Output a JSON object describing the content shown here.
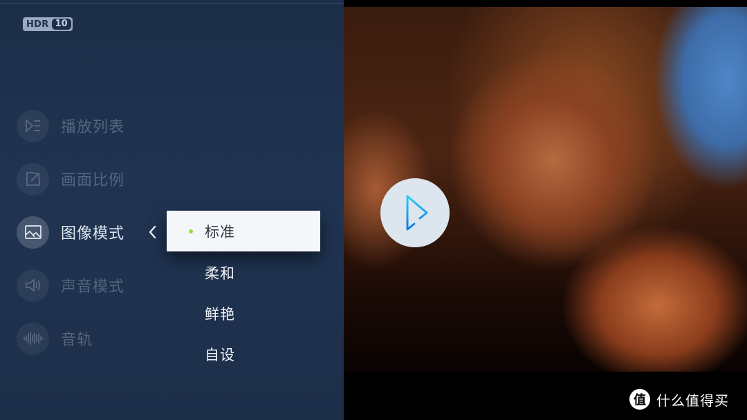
{
  "badge": {
    "hdr_label": "HDR",
    "hdr_version": "10"
  },
  "menu": {
    "items": [
      {
        "label": "播放列表",
        "icon": "playlist-icon",
        "active": false
      },
      {
        "label": "画面比例",
        "icon": "aspect-ratio-icon",
        "active": false
      },
      {
        "label": "图像模式",
        "icon": "picture-mode-icon",
        "active": true
      },
      {
        "label": "声音模式",
        "icon": "sound-mode-icon",
        "active": false
      },
      {
        "label": "音轨",
        "icon": "audio-track-icon",
        "active": false
      }
    ]
  },
  "submenu": {
    "back_icon": "chevron-left-icon",
    "selected_indicator_color": "#8fe03a",
    "options": [
      {
        "label": "标准",
        "selected": true
      },
      {
        "label": "柔和",
        "selected": false
      },
      {
        "label": "鲜艳",
        "selected": false
      },
      {
        "label": "自设",
        "selected": false
      }
    ]
  },
  "player": {
    "play_icon": "play-icon",
    "accent": "#1aa0e8"
  },
  "watermark": {
    "logo_char": "值",
    "text": "什么值得买"
  }
}
